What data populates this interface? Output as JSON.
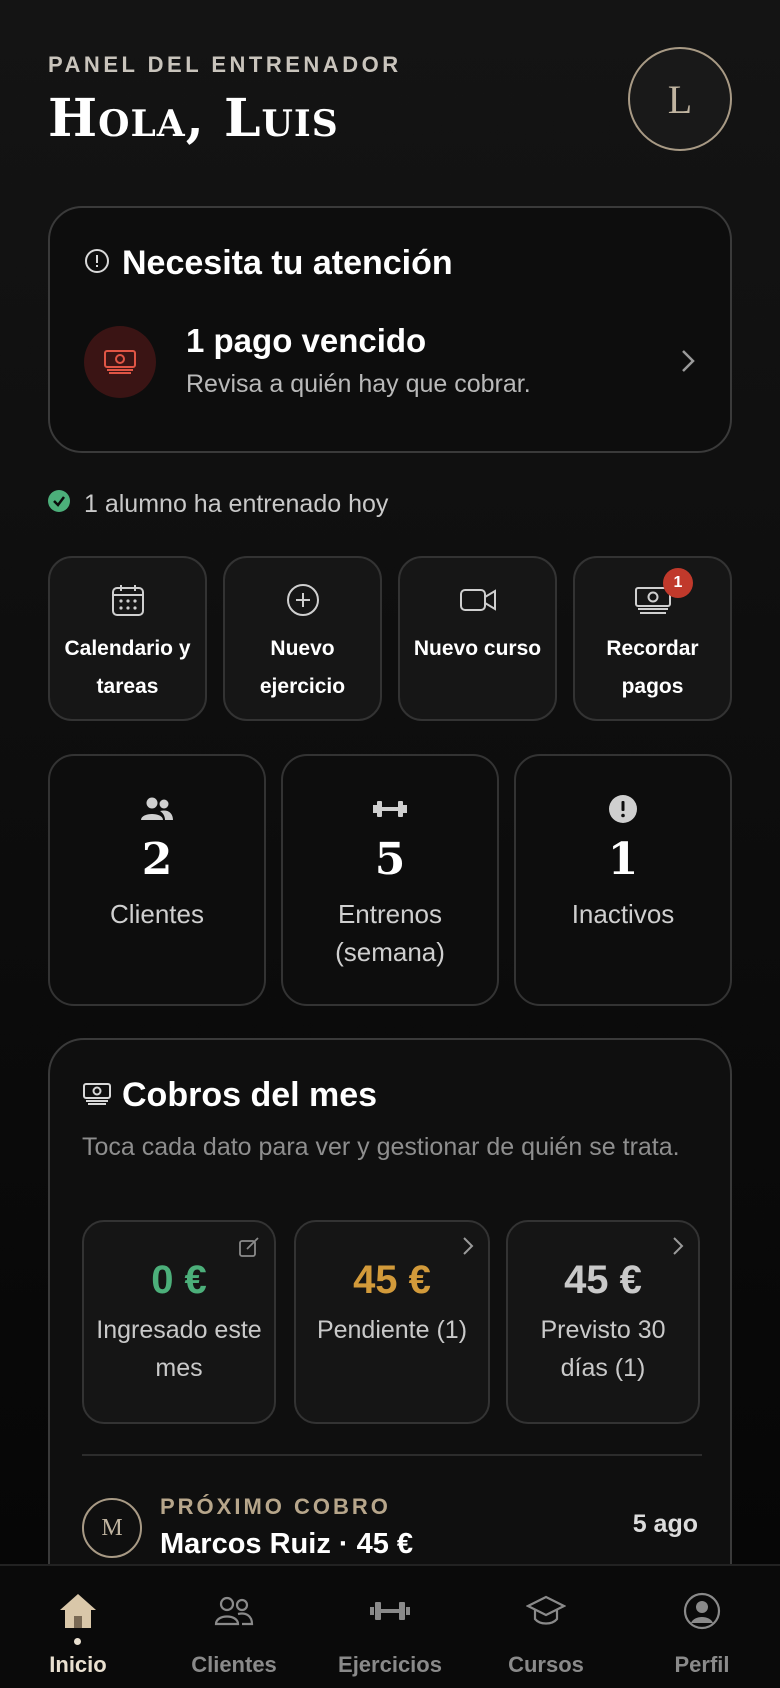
{
  "header": {
    "eyebrow": "PANEL DEL ENTRENADOR",
    "greeting": "Hola, Luis",
    "avatar_initial": "L"
  },
  "attention": {
    "title": "Necesita tu atención",
    "item_title": "1 pago vencido",
    "item_subtitle": "Revisa a quién hay que cobrar."
  },
  "status_line": "1 alumno ha entrenado hoy",
  "quick_actions": [
    {
      "label": "Calendario y tareas",
      "icon": "calendar-icon"
    },
    {
      "label": "Nuevo ejercicio",
      "icon": "plus-circle-icon"
    },
    {
      "label": "Nuevo curso",
      "icon": "video-icon"
    },
    {
      "label": "Recordar pagos",
      "icon": "money-icon",
      "badge": "1"
    }
  ],
  "stats": [
    {
      "value": "2",
      "label": "Clientes",
      "icon": "users-icon"
    },
    {
      "value": "5",
      "label": "Entrenos (semana)",
      "icon": "dumbbell-icon"
    },
    {
      "value": "1",
      "label": "Inactivos",
      "icon": "alert-icon"
    }
  ],
  "cobros": {
    "title": "Cobros del mes",
    "description": "Toca cada dato para ver y gestionar de quién se trata.",
    "metrics": [
      {
        "amount": "0 €",
        "label": "Ingresado este mes",
        "color": "#4caf7a"
      },
      {
        "amount": "45 €",
        "label": "Pendiente (1)",
        "color": "#d29a3a"
      },
      {
        "amount": "45 €",
        "label": "Previsto 30 días (1)",
        "color": "#c9c9c9"
      }
    ],
    "next": {
      "eyebrow": "PRÓXIMO COBRO",
      "initial": "M",
      "name": "Marcos Ruiz · 45 €",
      "date": "5 ago"
    }
  },
  "nav": [
    {
      "label": "Inicio",
      "icon": "home-icon",
      "active": true
    },
    {
      "label": "Clientes",
      "icon": "users-icon"
    },
    {
      "label": "Ejercicios",
      "icon": "dumbbell-icon"
    },
    {
      "label": "Cursos",
      "icon": "graduation-cap-icon"
    },
    {
      "label": "Perfil",
      "icon": "user-circle-icon"
    }
  ],
  "colors": {
    "accent": "#a89a85",
    "danger": "#c0392b",
    "success": "#4caf7a",
    "warning": "#d29a3a"
  }
}
